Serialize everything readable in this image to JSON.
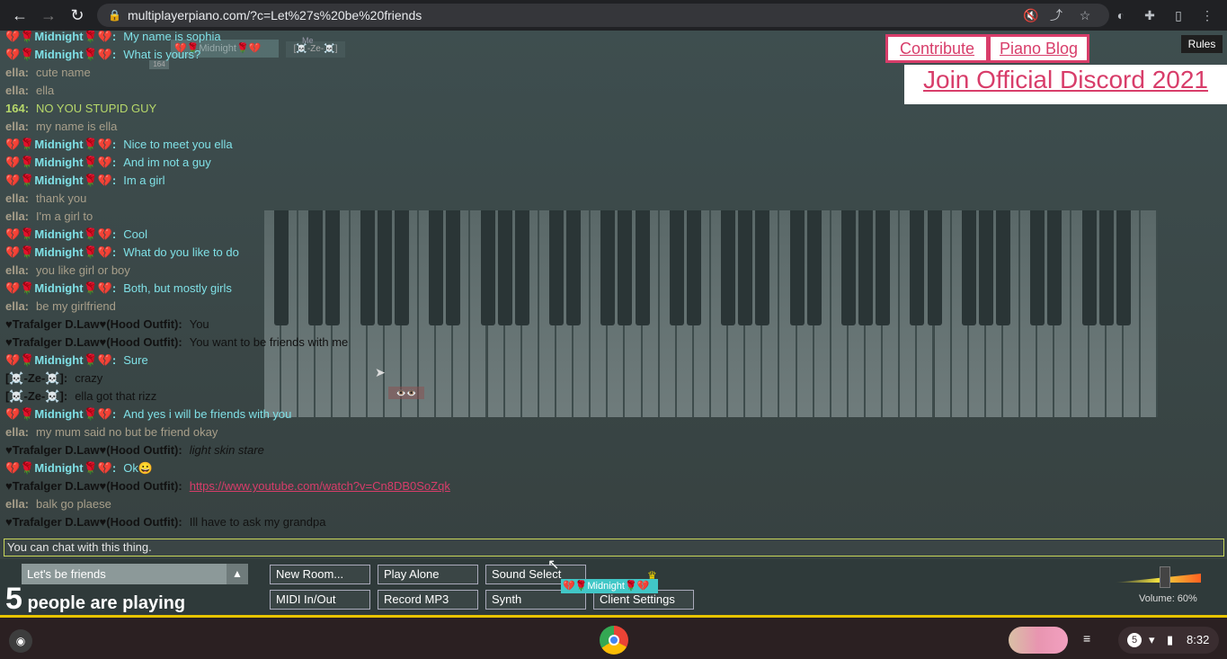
{
  "browser": {
    "url": "multiplayerpiano.com/?c=Let%27s%20be%20friends"
  },
  "header_links": {
    "contribute": "Contribute",
    "piano_blog": "Piano Blog",
    "discord": "Join Official Discord 2021",
    "rules": "Rules"
  },
  "ghost_cursors": {
    "label1": "💔🌹Midnight🌹💔",
    "label2": "[☠️-Ze-☠️]",
    "label3": "164",
    "label4": "👁️👁️",
    "me_label": "Me"
  },
  "chat": [
    {
      "nick": "💔🌹Midnight🌹💔:",
      "text": "My name is sophia",
      "color": "#7fe0e6"
    },
    {
      "nick": "💔🌹Midnight🌹💔:",
      "text": "What is yours?",
      "color": "#7fe0e6"
    },
    {
      "nick": "ella:",
      "text": "cute name",
      "color": "#a89f8a"
    },
    {
      "nick": "ella:",
      "text": "ella",
      "color": "#a89f8a"
    },
    {
      "nick": "164:",
      "text": "NO YOU STUPID GUY",
      "color": "#b7d86a"
    },
    {
      "nick": "ella:",
      "text": "my name is ella",
      "color": "#a89f8a"
    },
    {
      "nick": "💔🌹Midnight🌹💔:",
      "text": "Nice to meet you ella",
      "color": "#7fe0e6"
    },
    {
      "nick": "💔🌹Midnight🌹💔:",
      "text": "And im not a guy",
      "color": "#7fe0e6"
    },
    {
      "nick": "💔🌹Midnight🌹💔:",
      "text": "Im a girl",
      "color": "#7fe0e6"
    },
    {
      "nick": "ella:",
      "text": "thank you",
      "color": "#a89f8a"
    },
    {
      "nick": "ella:",
      "text": "I'm a girl to",
      "color": "#a89f8a"
    },
    {
      "nick": "💔🌹Midnight🌹💔:",
      "text": "Cool",
      "color": "#7fe0e6"
    },
    {
      "nick": "💔🌹Midnight🌹💔:",
      "text": "What do you like to do",
      "color": "#7fe0e6"
    },
    {
      "nick": "ella:",
      "text": "you like girl or boy",
      "color": "#a89f8a"
    },
    {
      "nick": "💔🌹Midnight🌹💔:",
      "text": "Both, but mostly girls",
      "color": "#7fe0e6"
    },
    {
      "nick": "ella:",
      "text": "be my girlfriend",
      "color": "#a89f8a"
    },
    {
      "nick": "♥Trafalger D.Law♥(Hood Outfit):",
      "text": "You",
      "color": "#111111"
    },
    {
      "nick": "♥Trafalger D.Law♥(Hood Outfit):",
      "text": "You want to be friends with me",
      "color": "#111111"
    },
    {
      "nick": "💔🌹Midnight🌹💔:",
      "text": "Sure",
      "color": "#7fe0e6"
    },
    {
      "nick": "[☠️-Ze-☠️]:",
      "text": "crazy",
      "color": "#111111"
    },
    {
      "nick": "[☠️-Ze-☠️]:",
      "text": "ella got that rizz",
      "color": "#111111"
    },
    {
      "nick": "💔🌹Midnight🌹💔:",
      "text": "And yes i will be friends with you",
      "color": "#7fe0e6"
    },
    {
      "nick": "ella:",
      "text": "my mum said no but be friend okay",
      "color": "#a89f8a"
    },
    {
      "nick": "♥Trafalger D.Law♥(Hood Outfit):",
      "text": "light skin stare",
      "color": "#111111",
      "italic": true
    },
    {
      "nick": "💔🌹Midnight🌹💔:",
      "text": "Ok😀",
      "color": "#7fe0e6"
    },
    {
      "nick": "♥Trafalger D.Law♥(Hood Outfit):",
      "text": "https://www.youtube.com/watch?v=Cn8DB0SoZqk",
      "color": "#111111",
      "link": true
    },
    {
      "nick": "ella:",
      "text": "balk go plaese",
      "color": "#a89f8a"
    },
    {
      "nick": "♥Trafalger D.Law♥(Hood Outfit):",
      "text": "Ill have to ask my grandpa",
      "color": "#111111"
    }
  ],
  "chat_input": {
    "placeholder": "You can chat with this thing."
  },
  "room": {
    "name": "Let's be friends",
    "arrow": "▲"
  },
  "people": {
    "count": "5",
    "label": "people are playing"
  },
  "buttons": {
    "new_room": "New Room...",
    "play_alone": "Play Alone",
    "sound_select": "Sound Select",
    "midi": "MIDI In/Out",
    "record": "Record MP3",
    "synth": "Synth",
    "client_settings": "Client Settings"
  },
  "bottom_name_label": "💔🌹Midnight🌹💔",
  "volume": {
    "label": "Volume: 60%",
    "value": 0.6
  },
  "shelf": {
    "notification_count": "5",
    "time": "8:32"
  },
  "colors": {
    "accent_link": "#d83d6a",
    "chat_border": "#c8d65a"
  }
}
